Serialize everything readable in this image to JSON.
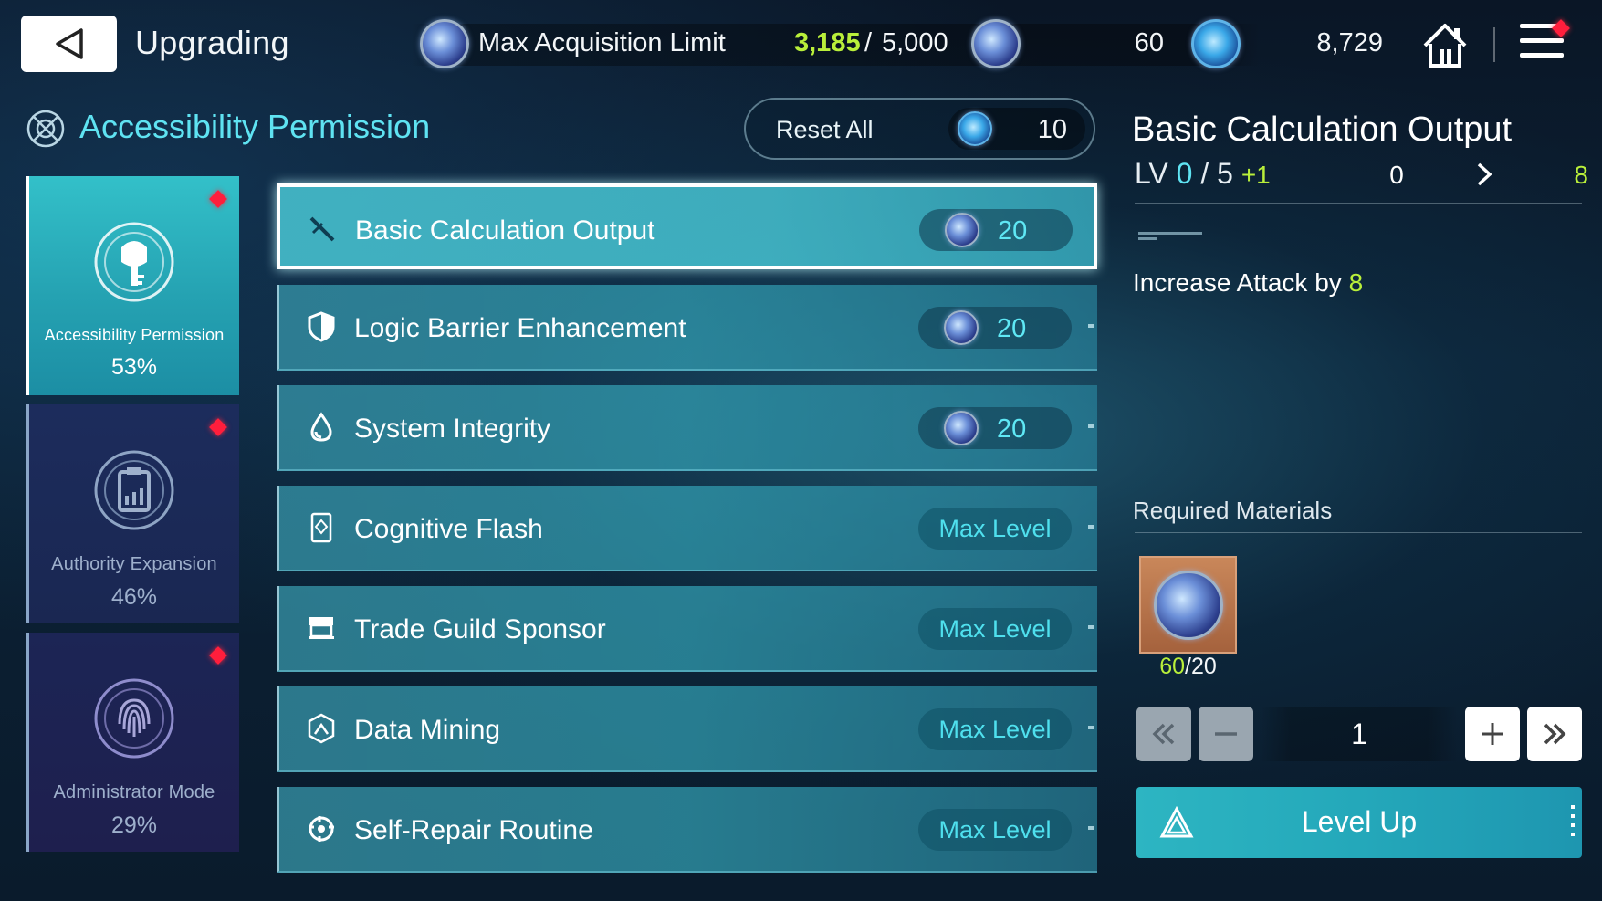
{
  "header": {
    "title": "Upgrading",
    "acquisition_label": "Max Acquisition Limit",
    "acquisition_current": "3,185",
    "acquisition_sep": "/",
    "acquisition_max": "5,000",
    "resource1_value": "60",
    "resource2_value": "8,729"
  },
  "section": {
    "title": "Accessibility Permission",
    "reset_label": "Reset All",
    "reset_cost": "10"
  },
  "categories": [
    {
      "label": "Accessibility Permission",
      "percent": "53%"
    },
    {
      "label": "Authority Expansion",
      "percent": "46%"
    },
    {
      "label": "Administrator Mode",
      "percent": "29%"
    }
  ],
  "skills": [
    {
      "name": "Basic Calculation Output",
      "cost": "20",
      "icon": "sword-icon"
    },
    {
      "name": "Logic Barrier Enhancement",
      "cost": "20",
      "icon": "shield-icon"
    },
    {
      "name": "System Integrity",
      "cost": "20",
      "icon": "droplet-icon"
    },
    {
      "name": "Cognitive Flash",
      "status": "Max Level",
      "icon": "card-icon"
    },
    {
      "name": "Trade Guild Sponsor",
      "status": "Max Level",
      "icon": "shop-icon"
    },
    {
      "name": "Data Mining",
      "status": "Max Level",
      "icon": "mining-icon"
    },
    {
      "name": "Self-Repair Routine",
      "status": "Max Level",
      "icon": "repair-icon"
    }
  ],
  "detail": {
    "title": "Basic Calculation Output",
    "lv_prefix": "LV",
    "lv_current": "0",
    "lv_sep": "/",
    "lv_max": "5",
    "lv_plus": "+1",
    "stat_from": "0",
    "stat_to": "8",
    "desc_prefix": "Increase Attack by",
    "desc_value": "8",
    "required_label": "Required Materials",
    "material_have": "60",
    "material_sep": "/",
    "material_need": "20",
    "quantity": "1",
    "level_up_label": "Level Up"
  },
  "colors": {
    "accent_cyan": "#5fe3f2",
    "accent_green": "#b9ef3a",
    "notification_red": "#ff1e3c"
  }
}
